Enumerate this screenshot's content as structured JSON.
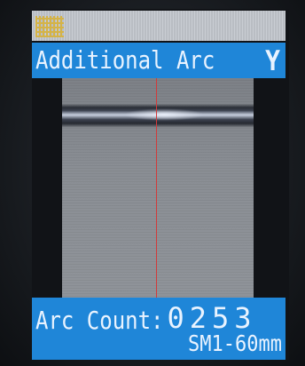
{
  "header": {
    "title": "Additional Arc",
    "value": "Y",
    "status_icon": "battery-icon"
  },
  "footer": {
    "count_label": "Arc Count:",
    "count_value": "0253",
    "profile": "SM1-60mm"
  },
  "colors": {
    "accent": "#1f86d8",
    "center_line": "#d23a3a"
  }
}
